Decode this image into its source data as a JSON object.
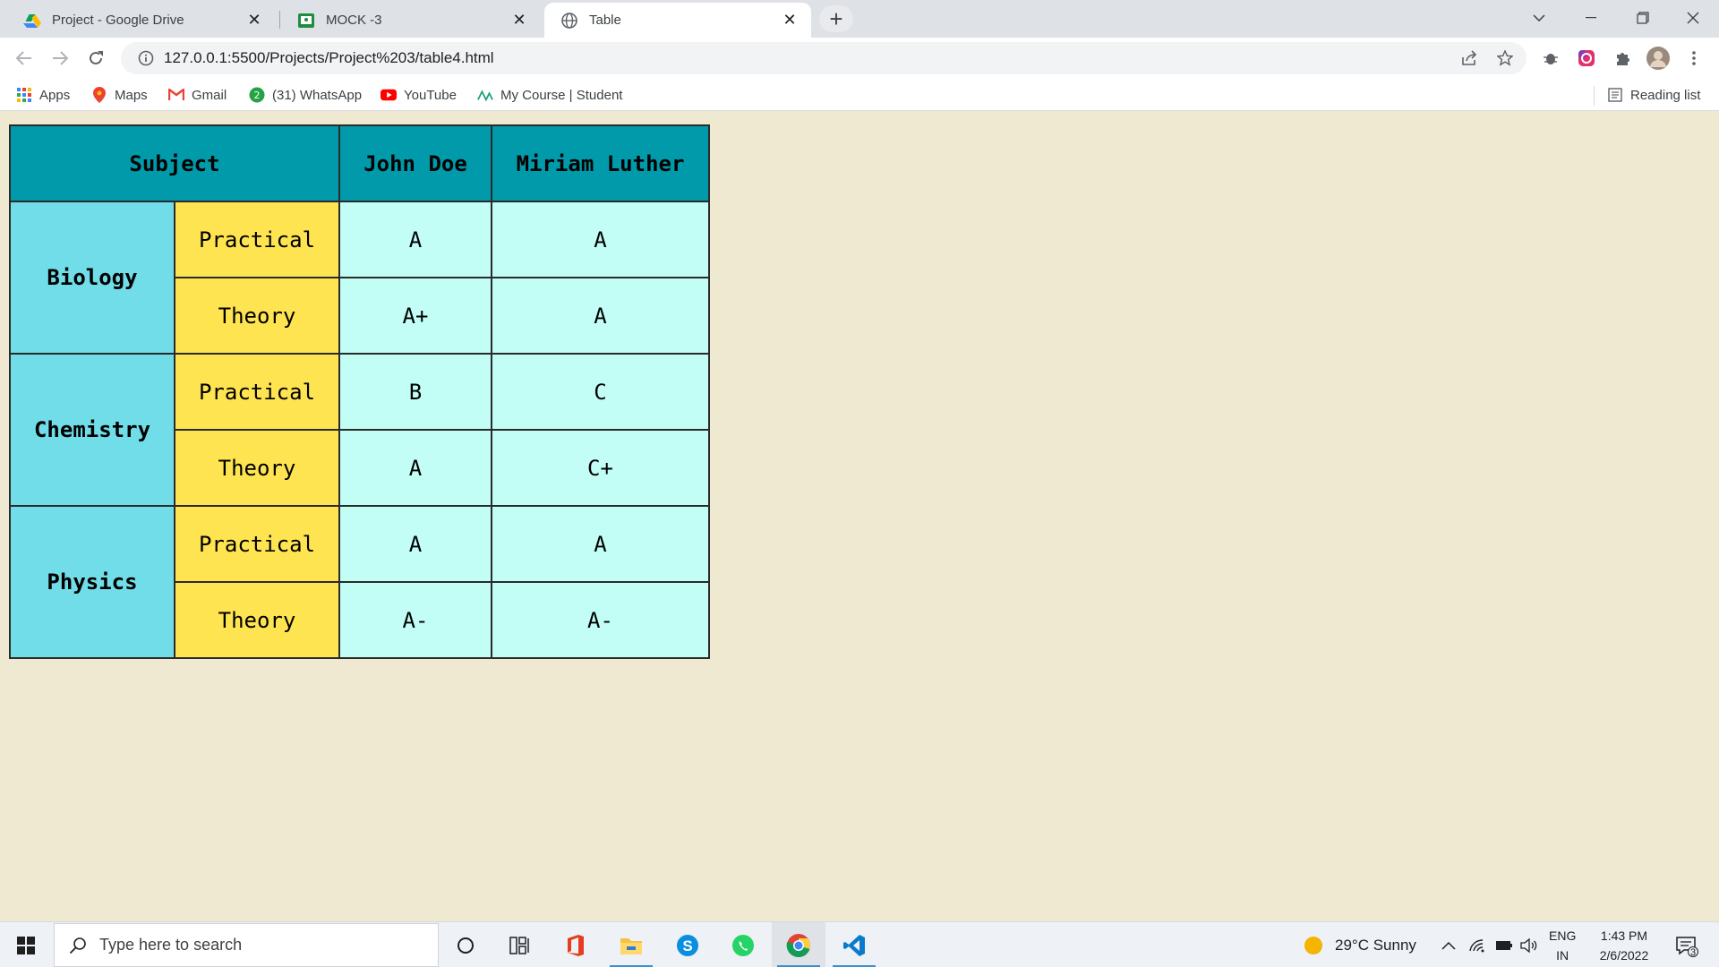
{
  "browser": {
    "tabs": [
      {
        "title": "Project - Google Drive",
        "icon": "google-drive-icon",
        "active": false
      },
      {
        "title": "MOCK -3",
        "icon": "google-classroom-icon",
        "active": false
      },
      {
        "title": "Table",
        "icon": "globe-icon",
        "active": true
      }
    ],
    "url": "127.0.0.1:5500/Projects/Project%203/table4.html",
    "bookmarks": [
      {
        "label": "Apps",
        "icon": "apps-grid-icon"
      },
      {
        "label": "Maps",
        "icon": "maps-pin-icon"
      },
      {
        "label": "Gmail",
        "icon": "gmail-icon"
      },
      {
        "label": "(31) WhatsApp",
        "icon": "whatsapp-icon"
      },
      {
        "label": "YouTube",
        "icon": "youtube-icon"
      },
      {
        "label": "My Course | Student",
        "icon": "course-icon"
      }
    ],
    "reading_list": "Reading list"
  },
  "table": {
    "header": {
      "subject": "Subject",
      "student1": "John Doe",
      "student2": "Miriam Luther"
    },
    "rows": [
      {
        "subject": "Biology",
        "kind1": "Practical",
        "kind2": "Theory",
        "g1": [
          "A",
          "A"
        ],
        "g2": [
          "A+",
          "A"
        ]
      },
      {
        "subject": "Chemistry",
        "kind1": "Practical",
        "kind2": "Theory",
        "g1": [
          "B",
          "C"
        ],
        "g2": [
          "A",
          "C+"
        ]
      },
      {
        "subject": "Physics",
        "kind1": "Practical",
        "kind2": "Theory",
        "g1": [
          "A",
          "A"
        ],
        "g2": [
          "A-",
          "A-"
        ]
      }
    ],
    "colors": {
      "header": "#019aab",
      "subject": "#71dde8",
      "kind": "#fee451",
      "grade": "#c2fdf6",
      "page": "#f0e9d2"
    }
  },
  "taskbar": {
    "search_placeholder": "Type here to search",
    "weather": "29°C  Sunny",
    "lang1": "ENG",
    "lang2": "IN",
    "time": "1:43 PM",
    "date": "2/6/2022",
    "notifications": "3"
  }
}
